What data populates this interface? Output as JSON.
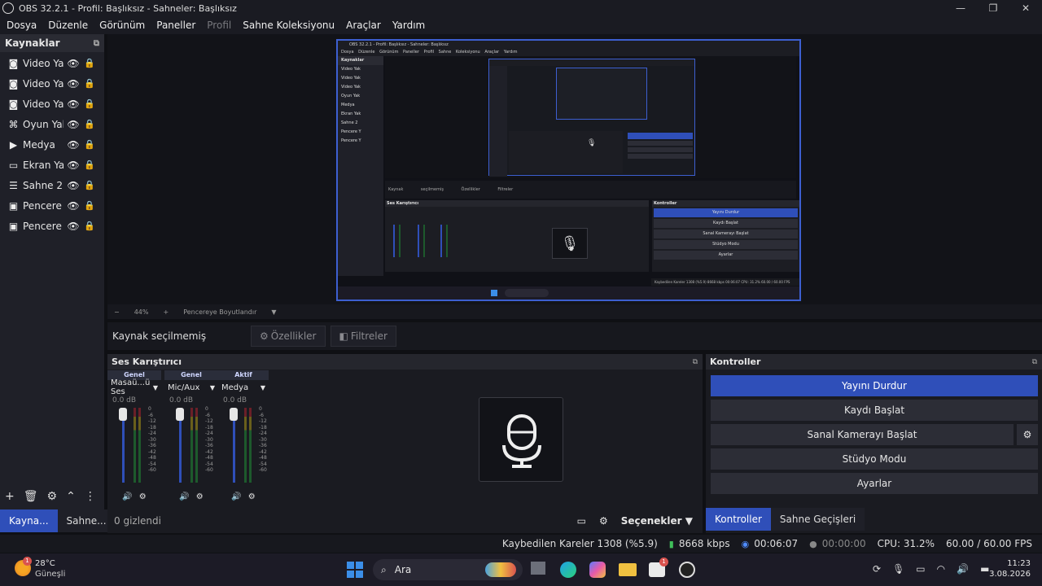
{
  "window": {
    "title": "OBS 32.2.1 - Profil: Başlıksız - Sahneler: Başlıksız",
    "minimize": "—",
    "maximize": "❐",
    "close": "✕"
  },
  "menu": [
    "Dosya",
    "Düzenle",
    "Görünüm",
    "Paneller",
    "Profil",
    "Sahne Koleksiyonu",
    "Araçlar",
    "Yardım"
  ],
  "sources": {
    "title": "Kaynaklar",
    "items": [
      {
        "icon": "camera-icon",
        "glyph": "◙",
        "label": "Video Yak"
      },
      {
        "icon": "camera-icon",
        "glyph": "◙",
        "label": "Video Yak"
      },
      {
        "icon": "camera-icon",
        "glyph": "◙",
        "label": "Video Yak"
      },
      {
        "icon": "gamepad-icon",
        "glyph": "⌘",
        "label": "Oyun Yak"
      },
      {
        "icon": "play-icon",
        "glyph": "▶",
        "label": "Medya"
      },
      {
        "icon": "monitor-icon",
        "glyph": "▭",
        "label": "Ekran Yak"
      },
      {
        "icon": "list-icon",
        "glyph": "☰",
        "label": "Sahne 2"
      },
      {
        "icon": "window-icon",
        "glyph": "▣",
        "label": "Pencere Y"
      },
      {
        "icon": "window-icon",
        "glyph": "▣",
        "label": "Pencere Y"
      }
    ]
  },
  "bottom_tabs": {
    "sources": "Kayna...",
    "scenes": "Sahne..."
  },
  "preview": {
    "zoom": "44%",
    "fit_label": "Pencereye Boyutlandır",
    "inner": {
      "title": "OBS 32.2.1 - Profil: Başlıksız - Sahneler: Başlıksız",
      "menu": "Dosya Düzenle Görünüm Paneller Profil Sahne Koleksiyonu Araçlar Yardım",
      "sources": [
        "Kaynaklar",
        "Video Yak",
        "Video Yak",
        "Video Yak",
        "Oyun Yak",
        "Medya",
        "Ekran Yak",
        "Sahne 2",
        "Pencere Y",
        "Pencere Y"
      ],
      "bar": "Kaynak seçilmemiş Özellikler Filtreler",
      "mixer_title": "Ses Karıştırıcı",
      "controls_title": "Kontroller",
      "buttons": [
        "Yayını Durdur",
        "Kaydı Başlat",
        "Sanal Kamerayı Başlat",
        "Stüdyo Modu",
        "Ayarlar"
      ],
      "status": "Kaybedilen Kareler 1308 (%5.9)  8668 kbps  00:06:07  CPU: 31.2%  60.00 / 60.00 FPS"
    }
  },
  "properties_bar": {
    "no_source": "Kaynak seçilmemiş",
    "properties": "Özellikler",
    "filters": "Filtreler"
  },
  "mixer": {
    "title": "Ses Karıştırıcı",
    "channels": [
      {
        "header": "Genel",
        "name": "Masaü...ü Ses",
        "db": "0.0 dB"
      },
      {
        "header": "Genel",
        "name": "Mic/Aux",
        "db": "0.0 dB"
      },
      {
        "header": "Aktif",
        "name": "Medya",
        "db": "0.0 dB"
      }
    ],
    "ticks": [
      "0",
      "-6",
      "-12",
      "-18",
      "-24",
      "-30",
      "-36",
      "-42",
      "-48",
      "-54",
      "-60"
    ],
    "hidden": "0 gizlendi",
    "options": "Seçenekler"
  },
  "controls": {
    "title": "Kontroller",
    "buttons": {
      "stream": "Yayını Durdur",
      "record": "Kaydı Başlat",
      "virtualcam": "Sanal Kamerayı Başlat",
      "studio": "Stüdyo Modu",
      "settings": "Ayarlar"
    },
    "tabs": {
      "controls": "Kontroller",
      "transitions": "Sahne Geçişleri"
    }
  },
  "status": {
    "dropped": "Kaybedilen Kareler 1308 (%5.9)",
    "bitrate": "8668 kbps",
    "stream_time": "00:06:07",
    "rec_time": "00:00:00",
    "cpu": "CPU: 31.2%",
    "fps": "60.00 / 60.00 FPS"
  },
  "taskbar": {
    "weather_temp": "28°C",
    "weather_desc": "Güneşli",
    "weather_badge": "1",
    "search": "Ara",
    "store_badge": "1",
    "time": "11:23",
    "date": "3.08.2026"
  },
  "colors": {
    "accent": "#2f4fb9",
    "bg": "#1a1b21"
  }
}
